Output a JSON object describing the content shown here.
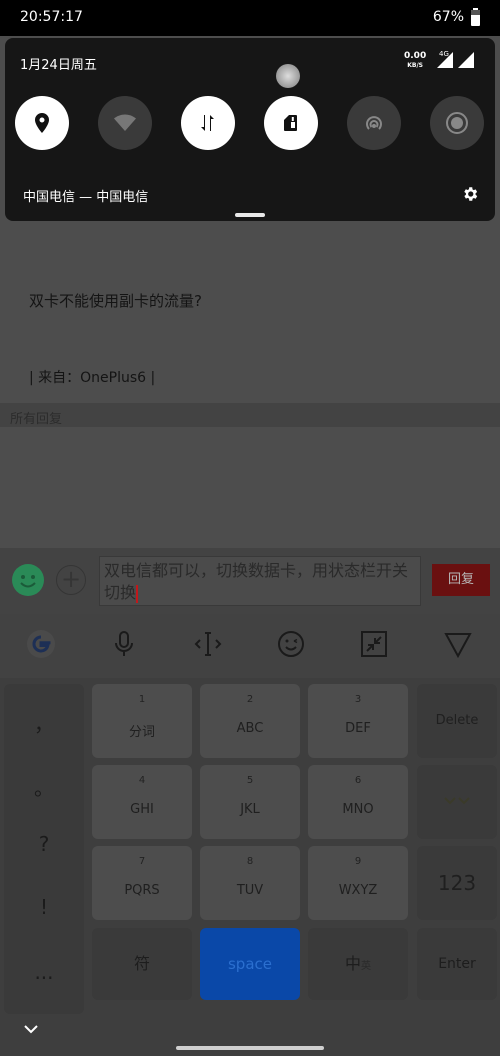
{
  "status_bar": {
    "time": "20:57:17",
    "battery": "67%"
  },
  "shade": {
    "date": "1月24日周五",
    "net_speed": "0.00",
    "net_unit": "KB/S",
    "net_type": "4G",
    "carrier": "中国电信 — 中国电信",
    "tiles": [
      {
        "icon": "location-icon",
        "state": "on"
      },
      {
        "icon": "wifi-icon",
        "state": "off"
      },
      {
        "icon": "mobile-data-icon",
        "state": "on"
      },
      {
        "icon": "sim-switch-icon",
        "state": "on"
      },
      {
        "icon": "hotspot-icon",
        "state": "off"
      },
      {
        "icon": "screen-record-icon",
        "state": "off"
      }
    ]
  },
  "post": {
    "question": "双卡不能使用副卡的流量?",
    "source": "| 来自：OnePlus6 |",
    "replies_label": "所有回复"
  },
  "reply": {
    "input_text": "双电信都可以，切换数据卡，用状态栏开关切换",
    "send_label": "回复"
  },
  "keyboard": {
    "punctuation": [
      "，",
      "。",
      "?",
      "!",
      "..."
    ],
    "keys": [
      {
        "num": "1",
        "label": "分词"
      },
      {
        "num": "2",
        "label": "ABC"
      },
      {
        "num": "3",
        "label": "DEF"
      },
      {
        "num": "4",
        "label": "GHI"
      },
      {
        "num": "5",
        "label": "JKL"
      },
      {
        "num": "6",
        "label": "MNO"
      },
      {
        "num": "7",
        "label": "PQRS"
      },
      {
        "num": "8",
        "label": "TUV"
      },
      {
        "num": "9",
        "label": "WXYZ"
      }
    ],
    "delete_label": "Delete",
    "numeric_label": "123",
    "symbol_label": "符",
    "space_label": "space",
    "lang_label": "中",
    "lang_sub": "英",
    "enter_label": "Enter"
  },
  "colors": {
    "accent_red": "#c1181b",
    "space_blue": "#0a48a8"
  }
}
